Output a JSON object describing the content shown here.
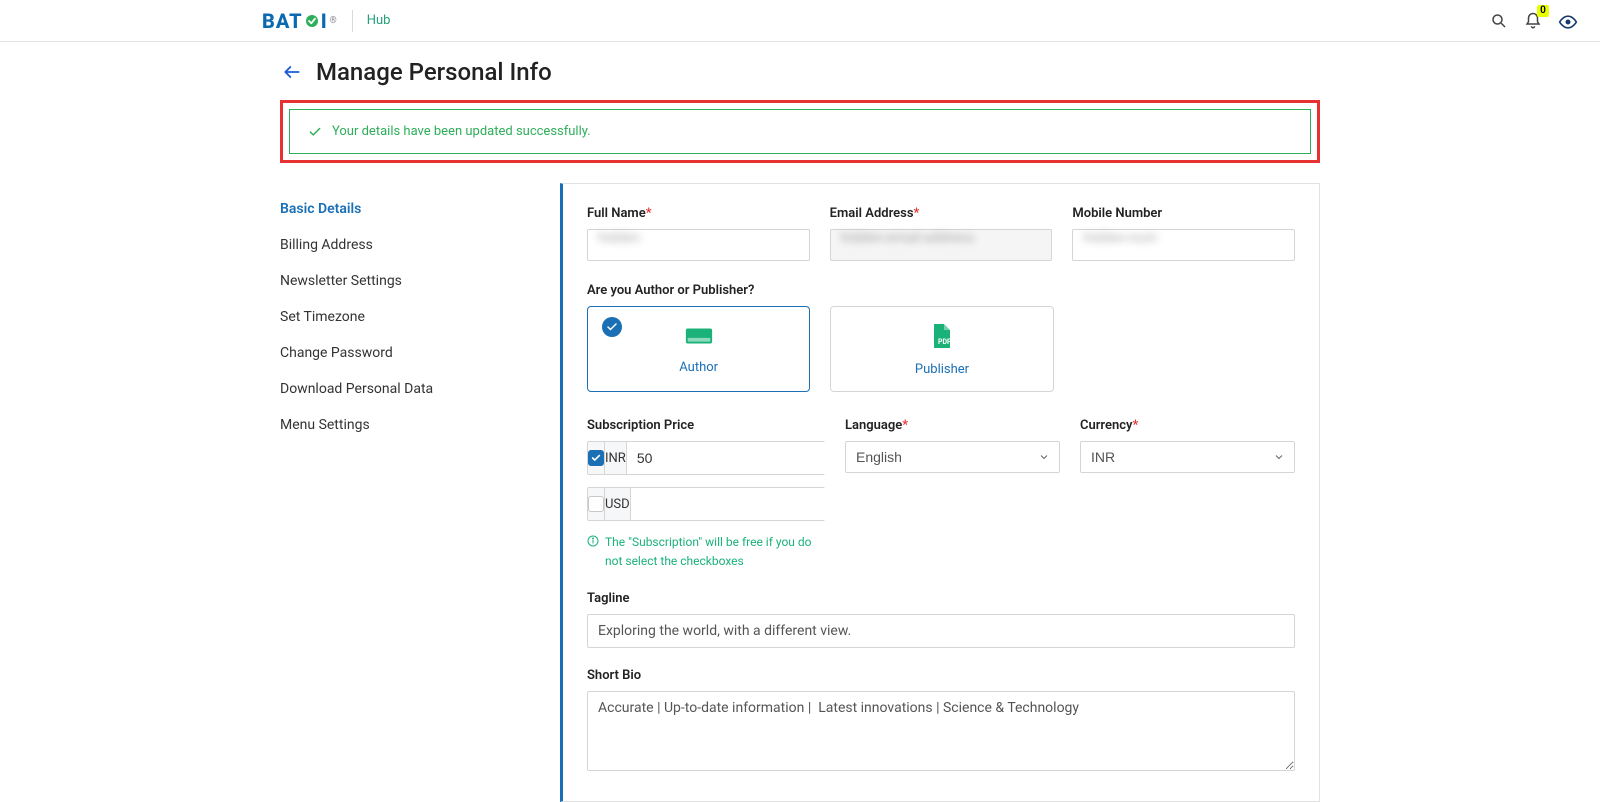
{
  "brand": {
    "name": "BAT",
    "name2": "I",
    "hub": "Hub"
  },
  "notifications": {
    "count": "0"
  },
  "page": {
    "title": "Manage Personal Info"
  },
  "alert": {
    "message": "Your details have been updated successfully."
  },
  "sidebar": {
    "items": [
      {
        "label": "Basic Details"
      },
      {
        "label": "Billing Address"
      },
      {
        "label": "Newsletter Settings"
      },
      {
        "label": "Set Timezone"
      },
      {
        "label": "Change Password"
      },
      {
        "label": "Download Personal Data"
      },
      {
        "label": "Menu Settings"
      }
    ]
  },
  "form": {
    "fullNameLabel": "Full Name",
    "emailLabel": "Email Address",
    "mobileLabel": "Mobile Number",
    "roleLabel": "Are you Author or Publisher?",
    "roles": {
      "author": "Author",
      "publisher": "Publisher"
    },
    "subPriceLabel": "Subscription Price",
    "languageLabel": "Language",
    "currencyLabel": "Currency",
    "priceCurrencies": {
      "inr": "INR",
      "usd": "USD"
    },
    "priceValues": {
      "inr": "50",
      "usd": ""
    },
    "hint": "The \"Subscription\" will be free if you do not select the checkboxes",
    "languageValue": "English",
    "currencyValue": "INR",
    "taglineLabel": "Tagline",
    "taglineValue": "Exploring the world, with a different view.",
    "bioLabel": "Short Bio",
    "bioValue": "Accurate | Up-to-date information |  Latest innovations | Science & Technology"
  }
}
